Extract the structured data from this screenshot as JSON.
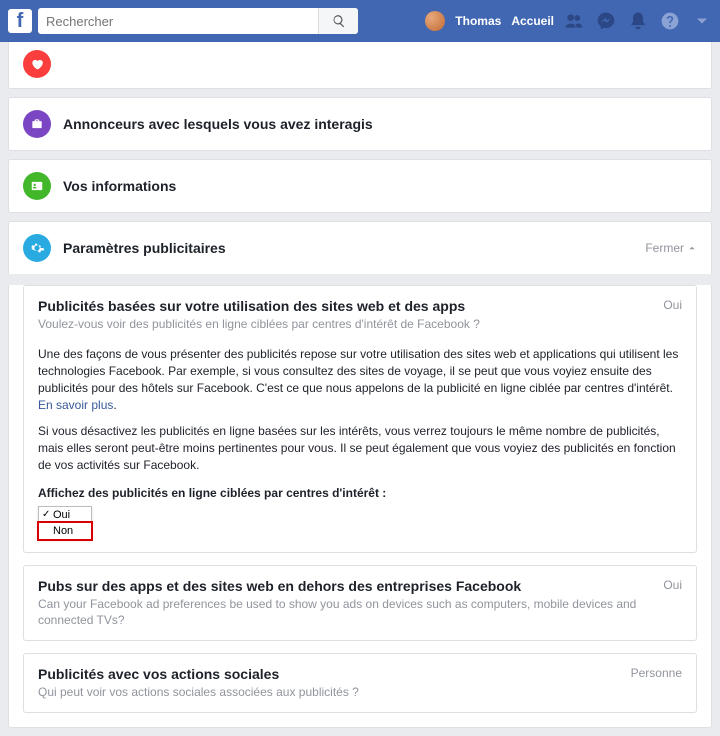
{
  "topbar": {
    "search_placeholder": "Rechercher",
    "user_name": "Thomas",
    "home_label": "Accueil"
  },
  "sections": {
    "advertisers": {
      "title": "Annonceurs avec lesquels vous avez interagis"
    },
    "your_info": {
      "title": "Vos informations"
    },
    "ad_settings": {
      "title": "Paramètres publicitaires",
      "close_label": "Fermer"
    }
  },
  "panel1": {
    "title": "Publicités basées sur votre utilisation des sites web et des apps",
    "subtitle": "Voulez-vous voir des publicités en ligne ciblées par centres d'intérêt de Facebook ?",
    "value": "Oui",
    "para1_a": "Une des façons de vous présenter des publicités repose sur votre utilisation des sites web et applications qui utilisent les technologies Facebook. Par exemple, si vous consultez des sites de voyage, il se peut que vous voyiez ensuite des publicités pour des hôtels sur Facebook. C'est ce que nous appelons de la publicité en ligne ciblée par centres d'intérêt. ",
    "learn_more": "En savoir plus",
    "para2": "Si vous désactivez les publicités en ligne basées sur les intérêts, vous verrez toujours le même nombre de publicités, mais elles seront peut-être moins pertinentes pour vous. Il se peut également que vous voyiez des publicités en fonction de vos activités sur Facebook.",
    "prompt": "Affichez des publicités en ligne ciblées par centres d'intérêt :",
    "opt_yes": "Oui",
    "opt_no": "Non"
  },
  "panel2": {
    "title": "Pubs sur des apps et des sites web en dehors des entreprises Facebook",
    "subtitle": "Can your Facebook ad preferences be used to show you ads on devices such as computers, mobile devices and connected TVs?",
    "value": "Oui"
  },
  "panel3": {
    "title": "Publicités avec vos actions sociales",
    "subtitle": "Qui peut voir vos actions sociales associées aux publicités ?",
    "value": "Personne"
  }
}
